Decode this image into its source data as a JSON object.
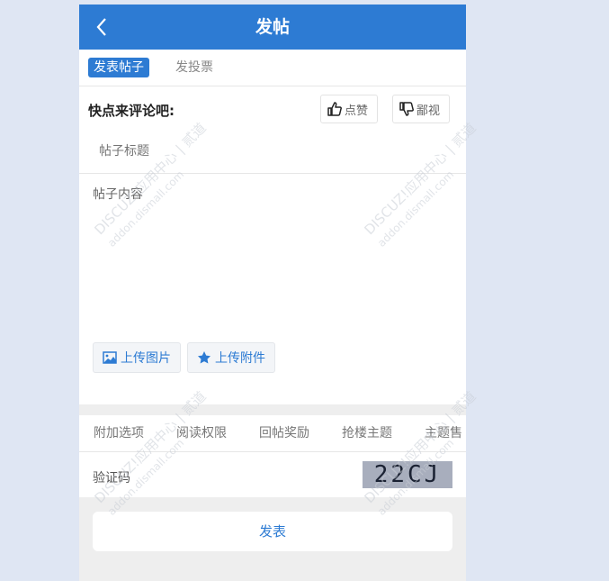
{
  "header": {
    "title": "发帖"
  },
  "modes": [
    {
      "label": "发表帖子"
    },
    {
      "label": "发投票"
    }
  ],
  "comment": {
    "label": "快点来评论吧:",
    "like_label": "点赞",
    "dislike_label": "鄙视"
  },
  "form": {
    "subject_placeholder": "帖子标题",
    "content_placeholder": "帖子内容",
    "upload_image_label": "上传图片",
    "upload_attachment_label": "上传附件"
  },
  "option_tabs": [
    {
      "label": "附加选项"
    },
    {
      "label": "阅读权限"
    },
    {
      "label": "回帖奖励"
    },
    {
      "label": "抢楼主题"
    },
    {
      "label": "主题售"
    }
  ],
  "captcha": {
    "label": "验证码",
    "code": "22CJ"
  },
  "submit": {
    "label": "发表"
  },
  "watermark": {
    "brand": "DISCUZ!应用中心",
    "site": "addon.dismall.com",
    "tag": "贰道"
  },
  "colors": {
    "accent": "#2d7bd3",
    "page_bg": "#dfe6f3"
  }
}
